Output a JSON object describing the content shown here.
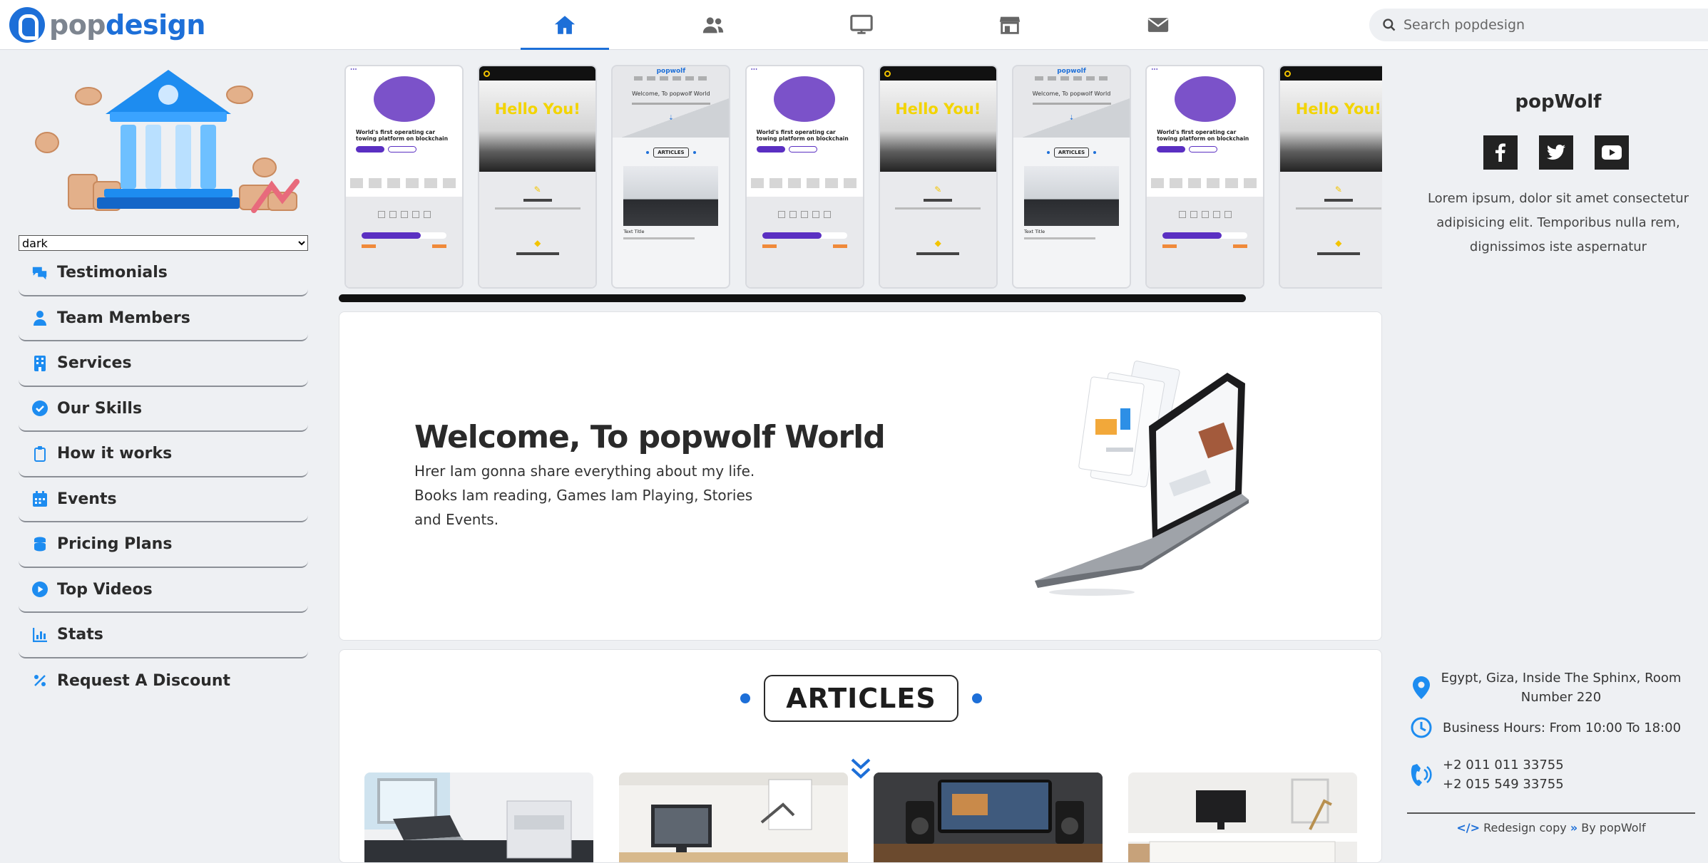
{
  "brand": {
    "name_part1": "pop",
    "name_part2": "design",
    "accent": "#1d6fd8"
  },
  "nav": {
    "items": [
      {
        "icon": "home-icon",
        "active": true
      },
      {
        "icon": "users-icon",
        "active": false
      },
      {
        "icon": "desktop-icon",
        "active": false
      },
      {
        "icon": "store-icon",
        "active": false
      },
      {
        "icon": "envelope-icon",
        "active": false
      }
    ]
  },
  "search": {
    "placeholder": "Search popdesign",
    "value": ""
  },
  "sidebar": {
    "theme_select": {
      "value": "dark"
    },
    "items": [
      {
        "label": "Testimonials",
        "icon": "comments-icon"
      },
      {
        "label": "Team Members",
        "icon": "user-icon"
      },
      {
        "label": "Services",
        "icon": "building-icon"
      },
      {
        "label": "Our Skills",
        "icon": "check-circle-icon"
      },
      {
        "label": "How it works",
        "icon": "clipboard-icon"
      },
      {
        "label": "Events",
        "icon": "calendar-icon"
      },
      {
        "label": "Pricing Plans",
        "icon": "coins-icon"
      },
      {
        "label": "Top Videos",
        "icon": "play-circle-icon"
      },
      {
        "label": "Stats",
        "icon": "chart-icon"
      },
      {
        "label": "Request A Discount",
        "icon": "percent-icon"
      }
    ]
  },
  "carousel": {
    "slides": [
      "purple",
      "hello",
      "popwolf",
      "purple",
      "hello",
      "popwolf",
      "purple",
      "hello"
    ],
    "texts": {
      "purple_heading": "World's first operating car towing platform on blockchain",
      "hello_heading": "Hello You!",
      "popwolf_logo": "popwolf",
      "popwolf_heading": "Welcome, To popwolf World",
      "popwolf_articles": "ARTICLES",
      "popwolf_text_title": "Text Title"
    }
  },
  "welcome": {
    "title": "Welcome, To popwolf World",
    "text": "Hrer Iam gonna share everything about my life. Books Iam reading, Games Iam Playing, Stories and Events."
  },
  "articles": {
    "title": "ARTICLES"
  },
  "profile": {
    "name": "popWolf",
    "socials": [
      "facebook-icon",
      "twitter-icon",
      "youtube-icon"
    ],
    "bio": "Lorem ipsum, dolor sit amet consectetur adipisicing elit. Temporibus nulla rem, dignissimos iste aspernatur"
  },
  "contact": {
    "address": "Egypt, Giza, Inside The Sphinx, Room Number 220",
    "hours": "Business Hours: From 10:00 To 18:00",
    "phone1": "+2 011 011 33755",
    "phone2": "+2 015 549 33755"
  },
  "footer": {
    "part1": "Redesign copy",
    "part2": "By popWolf"
  }
}
